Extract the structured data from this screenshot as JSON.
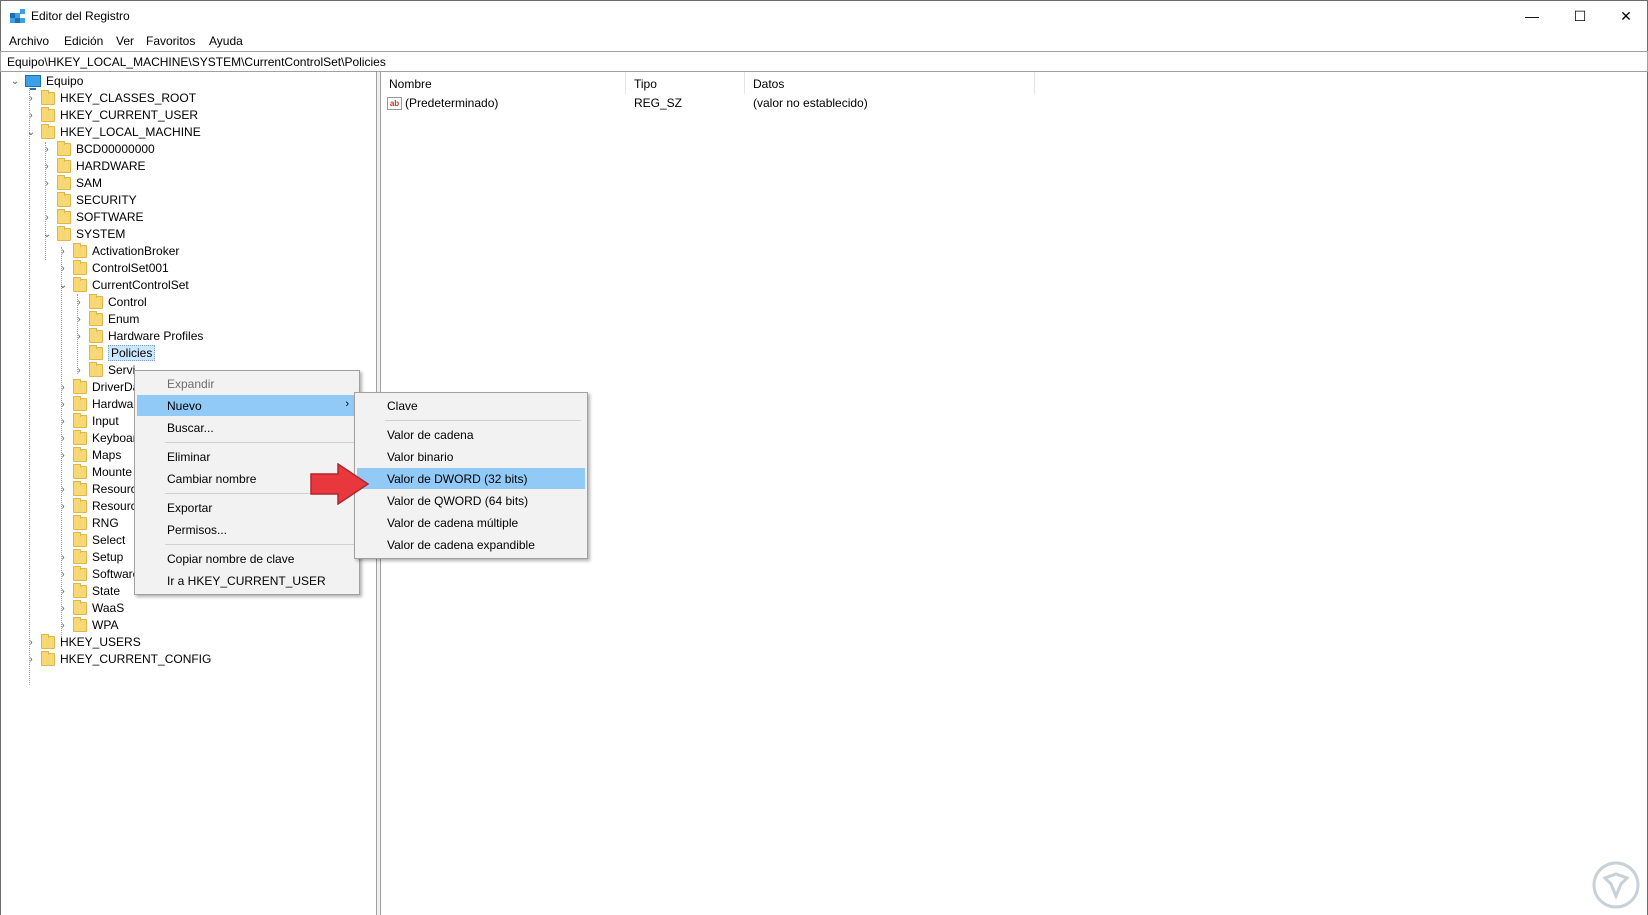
{
  "window": {
    "title": "Editor del Registro",
    "controls": {
      "minimize": "—",
      "maximize": "☐",
      "close": "✕"
    }
  },
  "menu": [
    "Archivo",
    "Edición",
    "Ver",
    "Favoritos",
    "Ayuda"
  ],
  "address": "Equipo\\HKEY_LOCAL_MACHINE\\SYSTEM\\CurrentControlSet\\Policies",
  "tree": {
    "root": "Equipo",
    "items": [
      "HKEY_CLASSES_ROOT",
      "HKEY_CURRENT_USER",
      "HKEY_LOCAL_MACHINE",
      "BCD00000000",
      "HARDWARE",
      "SAM",
      "SECURITY",
      "SOFTWARE",
      "SYSTEM",
      "ActivationBroker",
      "ControlSet001",
      "CurrentControlSet",
      "Control",
      "Enum",
      "Hardware Profiles",
      "Policies",
      "Servi",
      "DriverDa",
      "Hardwar",
      "Input",
      "Keyboar",
      "Maps",
      "Mounte",
      "Resourc",
      "Resourc",
      "RNG",
      "Select",
      "Setup",
      "Software",
      "State",
      "WaaS",
      "WPA",
      "HKEY_USERS",
      "HKEY_CURRENT_CONFIG"
    ]
  },
  "list": {
    "columns": [
      "Nombre",
      "Tipo",
      "Datos"
    ],
    "rows": [
      {
        "name": "(Predeterminado)",
        "type": "REG_SZ",
        "data": "(valor no establecido)",
        "icon": "ab"
      }
    ]
  },
  "context_menu": {
    "items": [
      "Expandir",
      "Nuevo",
      "Buscar...",
      "Eliminar",
      "Cambiar nombre",
      "Exportar",
      "Permisos...",
      "Copiar nombre de clave",
      "Ir a HKEY_CURRENT_USER"
    ],
    "submenu_arrow": "›"
  },
  "submenu": {
    "items": [
      "Clave",
      "Valor de cadena",
      "Valor binario",
      "Valor de DWORD (32 bits)",
      "Valor de QWORD (64 bits)",
      "Valor de cadena múltiple",
      "Valor de cadena expandible"
    ]
  },
  "colors": {
    "highlight": "#91c9f7",
    "folder": "#f8d775",
    "arrow": "#e8383d"
  }
}
